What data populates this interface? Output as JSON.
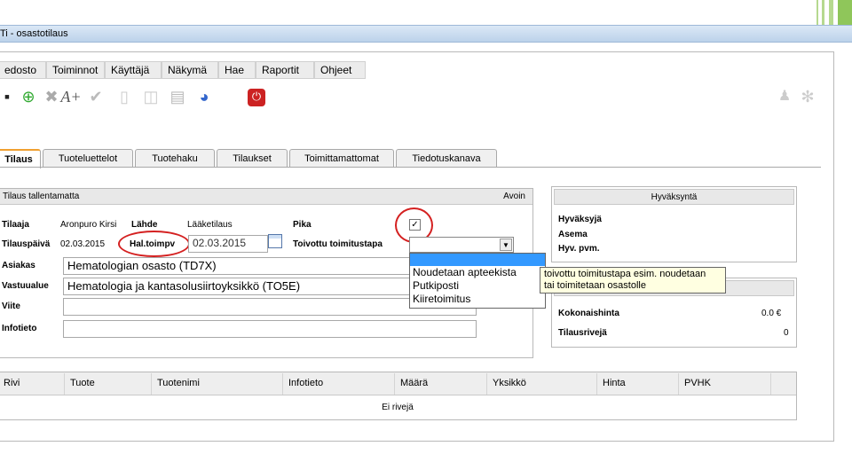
{
  "window": {
    "title": "Ti - osastotilaus"
  },
  "menu": [
    "edosto",
    "Toiminnot",
    "Käyttäjä",
    "Näkymä",
    "Hae",
    "Raportit",
    "Ohjeet"
  ],
  "tabs": [
    "Tilaus",
    "Tuoteluettelot",
    "Tuotehaku",
    "Tilaukset",
    "Toimittamattomat",
    "Tiedotuskanava"
  ],
  "order": {
    "header": "Tilaus tallentamatta",
    "status": "Avoin",
    "tilaaja_label": "Tilaaja",
    "tilaaja_value": "Aronpuro Kirsi",
    "lahde_label": "Lähde",
    "lahde_value": "Lääketilaus",
    "pika_label": "Pika",
    "pika_checked": "✓",
    "tilauspaiva_label": "Tilauspäivä",
    "tilauspaiva_value": "02.03.2015",
    "haltoimpv_label": "Hal.toimpv",
    "haltoimpv_value": "02.03.2015",
    "toivottu_label": "Toivottu toimitustapa",
    "asiakas_label": "Asiakas",
    "asiakas_value": "Hematologian osasto (TD7X)",
    "vastuualue_label": "Vastuualue",
    "vastuualue_value": "Hematologia ja kantasolusiirtoyksikkö (TO5E)",
    "viite_label": "Viite",
    "infotieto_label": "Infotieto"
  },
  "dropdown_options": [
    "",
    "Noudetaan apteekista",
    "Putkiposti",
    "Kiiretoimitus"
  ],
  "tooltip": {
    "line1": "toivottu toimitustapa esim. noudetaan",
    "line2": "tai toimitetaan osastolle"
  },
  "approval": {
    "title": "Hyväksyntä",
    "hyvaksyja": "Hyväksyjä",
    "asema": "Asema",
    "hyvpvm": "Hyv. pvm."
  },
  "totals": {
    "kokonaishinta_label": "Kokonaishinta",
    "kokonaishinta_value": "0.0 €",
    "tilausriveja_label": "Tilausrivejä",
    "tilausriveja_value": "0"
  },
  "table": {
    "columns": [
      "Rivi",
      "Tuote",
      "Tuotenimi",
      "Infotieto",
      "Määrä",
      "Yksikkö",
      "Hinta",
      "PVHK"
    ],
    "empty": "Ei rivejä"
  },
  "colors": {
    "accent_tab": "#f0a030",
    "annotation_red": "#d42020",
    "selection_blue": "#3399ff",
    "tooltip_bg": "#ffffe1"
  }
}
